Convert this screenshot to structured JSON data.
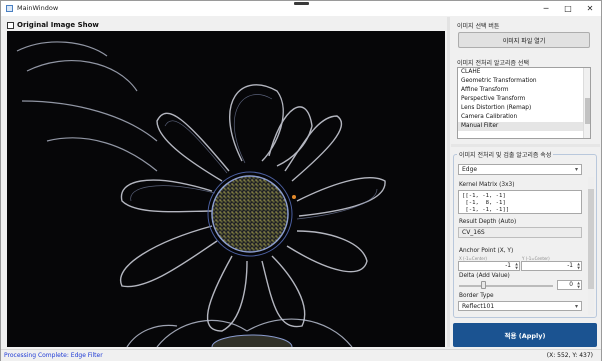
{
  "window": {
    "title": "MainWindow",
    "minimize_glyph": "─",
    "maximize_glyph": "□",
    "close_glyph": "✕"
  },
  "left_panel": {
    "show_original_label": "Original Image Show",
    "show_original_checked": false
  },
  "right_panel": {
    "image_select_label": "이미지 선택 버튼",
    "open_file_button": "이미지 파일 열기",
    "algo_select_label": "이미지 전처리 알고리즘 선택",
    "algorithms": [
      "CLAHE",
      "Geometric Transformation",
      "Affine Transform",
      "Perspective Transform",
      "Lens Distortion (Remap)",
      "Camera Calibration",
      "Manual Filter"
    ],
    "selected_algorithm": "Manual Filter"
  },
  "properties": {
    "group_title": "이미지 전처리 및 검출 알고리즘 속성",
    "filter_type": "Edge",
    "kernel_label": "Kernel Matrix (3x3)",
    "kernel_text": "[[-1, -1, -1]\n [-1,  8, -1]\n [-1, -1, -1]]",
    "result_depth_label": "Result Depth (Auto)",
    "result_depth_value": "CV_16S",
    "anchor_label": "Anchor Point (X, Y)",
    "anchor_x_hint": "X (-1=Center)",
    "anchor_y_hint": "Y (-1=Center)",
    "anchor_x": "-1",
    "anchor_y": "-1",
    "delta_label": "Delta (Add Value)",
    "delta_value": "0",
    "delta_fraction": 0.25,
    "border_label": "Border Type",
    "border_value": "Reflect101"
  },
  "apply_button": "적용 (Apply)",
  "status": {
    "message": "Processing Complete: Edge Filter",
    "coordinates": "(X: 552, Y: 437)"
  },
  "colors": {
    "apply_bg": "#1b5391",
    "status_text": "#1f3bd6",
    "image_bg": "#060608"
  }
}
